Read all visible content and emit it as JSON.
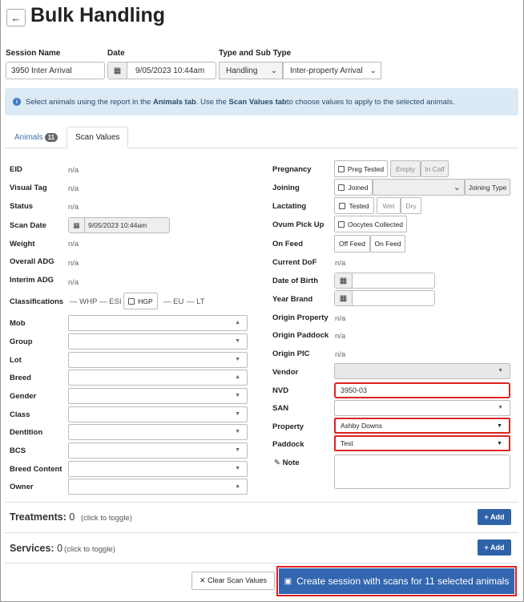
{
  "header": {
    "back_icon": "←",
    "title": "Bulk Handling"
  },
  "session": {
    "name_label": "Session Name",
    "name_value": "3950 Inter Arrival",
    "date_label": "Date",
    "date_value": "9/05/2023 10:44am",
    "type_label": "Type and Sub Type",
    "type_value": "Handling",
    "subtype_value": "Inter-property Arrival"
  },
  "info": {
    "pre": "Select animals using the report in the ",
    "tab1": "Animals tab",
    "mid": " . Use the ",
    "tab2": "Scan Values tab",
    "post": " to choose values to apply to the selected animals."
  },
  "tabs": {
    "animals": "Animals",
    "animals_count": "11",
    "scan": "Scan Values"
  },
  "left": {
    "eid": "EID",
    "eid_v": "n/a",
    "visual": "Visual Tag",
    "visual_v": "n/a",
    "status": "Status",
    "status_v": "n/a",
    "scan_date": "Scan Date",
    "scan_date_v": "9/05/2023 10:44am",
    "weight": "Weight",
    "weight_v": "n/a",
    "overall": "Overall ADG",
    "overall_v": "n/a",
    "interim": "Interim ADG",
    "interim_v": "n/a",
    "class": "Classifications",
    "c1": "WHP",
    "c2": "ESI",
    "c3": "HGP",
    "c4": "EU",
    "c5": "LT",
    "mob": "Mob",
    "group": "Group",
    "lot": "Lot",
    "breed": "Breed",
    "gender": "Gender",
    "klass": "Class",
    "dentition": "Dentition",
    "bcs": "BCS",
    "breed_content": "Breed Content",
    "owner": "Owner"
  },
  "right": {
    "preg": "Pregnancy",
    "preg_b1": "Preg Tested",
    "preg_b2": "Empty",
    "preg_b3": "In Calf",
    "joining": "Joining",
    "joined": "Joined",
    "joining_type": "Joining Type",
    "lact": "Lactating",
    "tested": "Tested",
    "wet": "Wet",
    "dry": "Dry",
    "ovum": "Ovum Pick Up",
    "oocytes": "Oocytes Collected",
    "onfeed": "On Feed",
    "off_btn": "Off Feed",
    "on_btn": "On Feed",
    "dof": "Current DoF",
    "dof_v": "n/a",
    "dob": "Date of Birth",
    "year": "Year Brand",
    "oprop": "Origin Property",
    "oprop_v": "n/a",
    "opad": "Origin Paddock",
    "opad_v": "n/a",
    "opic": "Origin PIC",
    "opic_v": "n/a",
    "vendor": "Vendor",
    "nvd": "NVD",
    "nvd_v": "3950-03",
    "san": "SAN",
    "property": "Property",
    "property_v": "Ashby Downs",
    "paddock": "Paddock",
    "paddock_v": "Test",
    "note": "Note"
  },
  "treat": {
    "title": "Treatments:",
    "count": "0",
    "hint": "(click to toggle)",
    "add": "+ Add"
  },
  "serv": {
    "title": "Services:",
    "count": "0",
    "hint": "(click to toggle)",
    "add": "+ Add"
  },
  "footer": {
    "clear": "✕ Clear Scan Values",
    "create": "Create session with scans for 11 selected animals"
  }
}
